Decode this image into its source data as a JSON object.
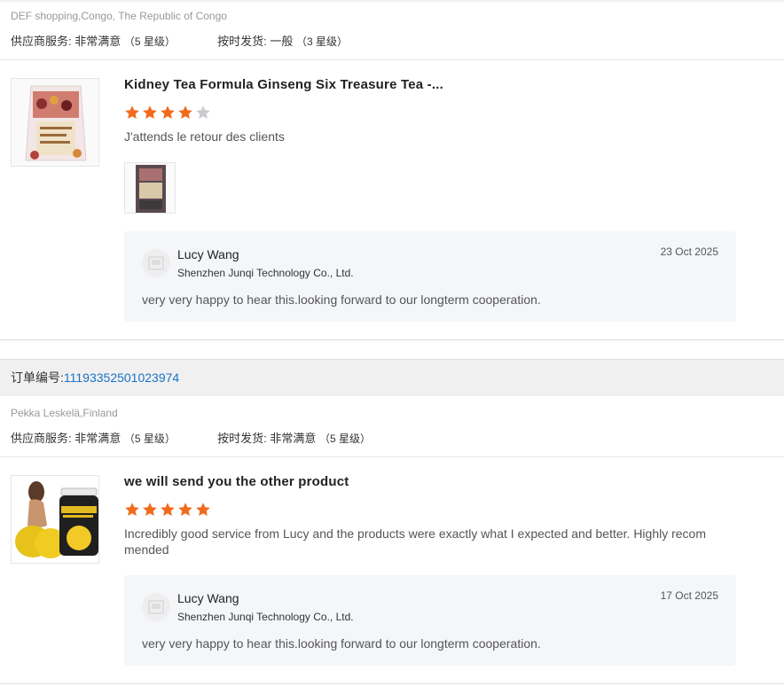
{
  "reviews": [
    {
      "buyer": "DEF shopping,Congo, The Republic of Congo",
      "supplier_service_label": "供应商服务:",
      "supplier_service_value": "非常满意",
      "supplier_service_level": "（5 星级）",
      "on_time_label": "按时发货:",
      "on_time_value": "一般",
      "on_time_level": "（3 星级）",
      "product_title": "Kidney Tea Formula Ginseng Six Treasure Tea -...",
      "rating": 4,
      "review_text": "J'attends le retour des clients",
      "has_review_image": true,
      "reply": {
        "name": "Lucy Wang",
        "company": "Shenzhen Junqi Technology Co., Ltd.",
        "date": "23 Oct 2025",
        "text": "very very happy to hear this.looking forward to our longterm cooperation."
      }
    },
    {
      "order_label": "订单编号:",
      "order_number": "11193352501023974",
      "buyer": "Pekka Leskelä,Finland",
      "supplier_service_label": "供应商服务:",
      "supplier_service_value": "非常满意",
      "supplier_service_level": "（5 星级）",
      "on_time_label": "按时发货:",
      "on_time_value": "非常满意",
      "on_time_level": "（5 星级）",
      "product_title": "we will send you the other product",
      "rating": 5,
      "review_text": "Incredibly good service from Lucy and the products were exactly what I expected and better. Highly recom mended",
      "has_review_image": false,
      "reply": {
        "name": "Lucy Wang",
        "company": "Shenzhen Junqi Technology Co., Ltd.",
        "date": "17 Oct 2025",
        "text": "very very happy to hear this.looking forward to our longterm cooperation."
      }
    }
  ],
  "colors": {
    "star_filled": "#f26b1d",
    "star_empty": "#c8ccd0",
    "order_link": "#1a73c8",
    "reply_bg": "#f4f6f9"
  },
  "icons": {
    "star": "star-icon",
    "avatar": "avatar-placeholder-icon"
  }
}
